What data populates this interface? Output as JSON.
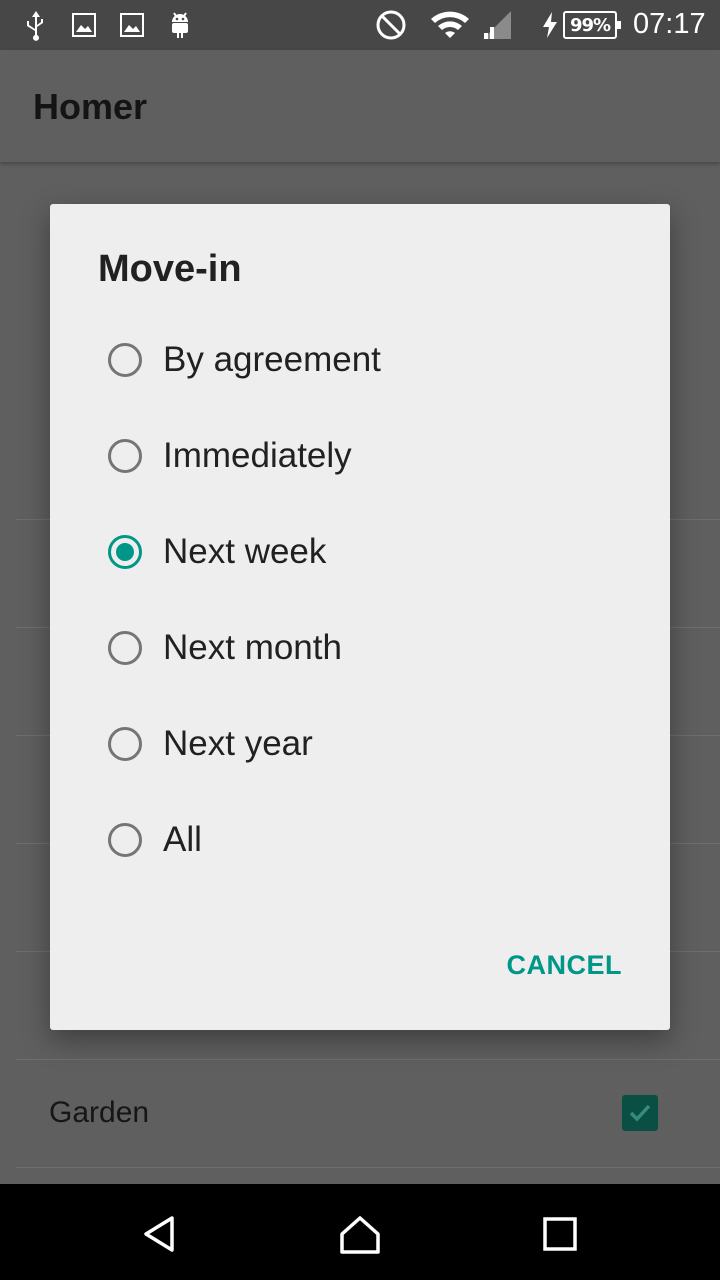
{
  "status_bar": {
    "icons_left": [
      "usb-icon",
      "image-icon",
      "image-icon",
      "android-icon"
    ],
    "icons_right": [
      "do-not-disturb-icon",
      "wifi-icon",
      "signal-icon",
      "charging-icon"
    ],
    "battery": "99%",
    "time": "07:17"
  },
  "app_bar": {
    "title": "Homer"
  },
  "background_list": {
    "garden_label": "Garden",
    "garden_checked": true
  },
  "dialog": {
    "title": "Move-in",
    "options": [
      {
        "label": "By agreement",
        "checked": false
      },
      {
        "label": "Immediately",
        "checked": false
      },
      {
        "label": "Next week",
        "checked": true
      },
      {
        "label": "Next month",
        "checked": false
      },
      {
        "label": "Next year",
        "checked": false
      },
      {
        "label": "All",
        "checked": false
      }
    ],
    "cancel_label": "CANCEL"
  },
  "nav_bar": {
    "buttons": [
      "back-icon",
      "home-icon",
      "recents-icon"
    ]
  },
  "colors": {
    "accent": "#009688",
    "scrim": "#5f5f5f",
    "dialog_bg": "#eeeeee"
  }
}
